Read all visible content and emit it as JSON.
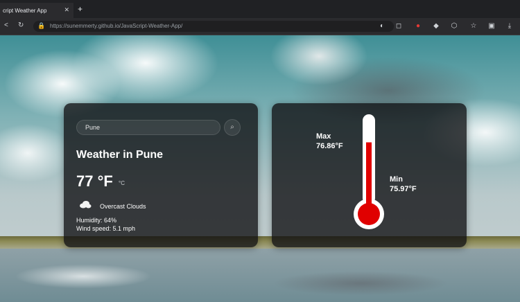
{
  "browser": {
    "tab_title": "cript Weather App",
    "tab_close": "✕",
    "new_tab": "+",
    "url": "https://sunemmerty.github.io/JavaScript-Weather-App/"
  },
  "weather": {
    "search_value": "Pune",
    "title": "Weather in Pune",
    "temp": "77 °F",
    "unit_toggle": "°C",
    "description": "Overcast Clouds",
    "humidity": "Humidity: 64%",
    "wind": "Wind speed: 5.1 mph"
  },
  "thermometer": {
    "max_label": "Max",
    "max_value": "76.86°F",
    "min_label": "Min",
    "min_value": "75.97°F",
    "fill_fraction": 0.75,
    "mercury_color": "#e00000"
  }
}
